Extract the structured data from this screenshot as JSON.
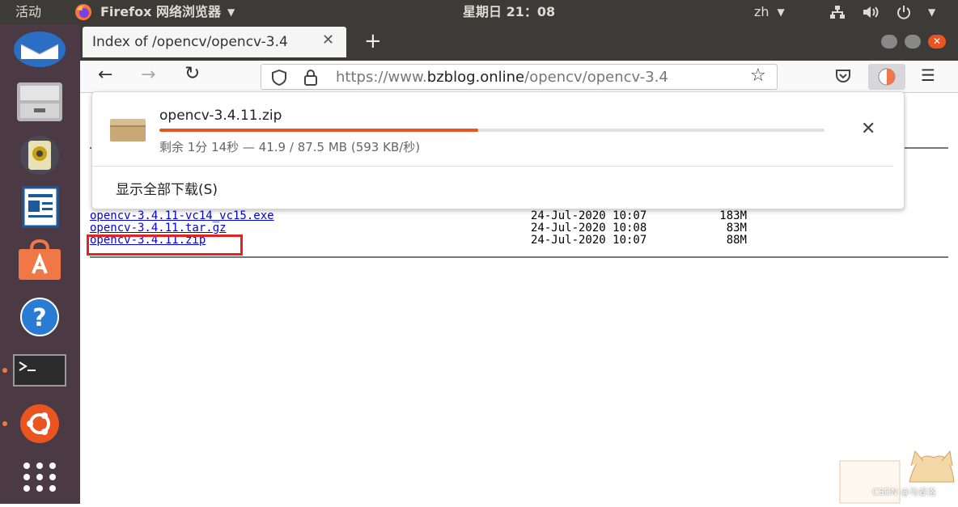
{
  "topbar": {
    "activities": "活动",
    "app_menu": "Firefox 网络浏览器",
    "clock": "星期日 21：08",
    "lang": "zh"
  },
  "tab": {
    "title": "Index of /opencv/opencv-3.4"
  },
  "url": {
    "host_prefix": "https://www.",
    "host": "bzblog.online",
    "path": "/opencv/opencv-3.4"
  },
  "listing": {
    "files": [
      {
        "name": "opencv-3.4.11-vc14_vc15.exe",
        "date": "24-Jul-2020 10:07",
        "size": "183M"
      },
      {
        "name": "opencv-3.4.11.tar.gz",
        "date": "24-Jul-2020 10:08",
        "size": "83M"
      },
      {
        "name": "opencv-3.4.11.zip",
        "date": "24-Jul-2020 10:07",
        "size": "88M"
      }
    ]
  },
  "download": {
    "filename": "opencv-3.4.11.zip",
    "progress": 0.479,
    "status": "剩余 1分 14秒 — 41.9 / 87.5 MB (593 KB/秒)",
    "show_all": "显示全部下载(S)"
  },
  "watermark": "CSDN @马睿洛",
  "colors": {
    "accent": "#f07746",
    "panel_bar": "#e95420",
    "highlight_box": "#e02424"
  }
}
